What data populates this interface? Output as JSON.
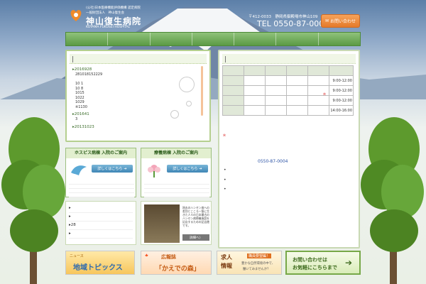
{
  "header": {
    "logo_sub1": "(公社)日本医療機能評価機構 認定病院",
    "logo_sub2": "一般財団法人　神山復生会",
    "logo_name": "神山復生病院",
    "logo_roman": "KOYAMA FUKUSEI HOSPITAL",
    "address": "〒412-0033　静岡県御殿場市神山109",
    "tel": "TEL 0550-87-0004",
    "contact_label": "お問い合わせ"
  },
  "news": {
    "entries": [
      {
        "date": "▸2016928",
        "lines": [
          "281018152229",
          "",
          "10  1",
          "10  8",
          "1015",
          "1022",
          "1029",
          "※1130"
        ]
      },
      {
        "date": "▸201641",
        "lines": [
          "3"
        ]
      },
      {
        "date": "▸20131023",
        "lines": []
      }
    ]
  },
  "schedule": {
    "times": [
      "9:00-12:00",
      "9:00-12:00",
      "9:00-12:00",
      "14:00-16:00"
    ],
    "tel": "0550-87-0004"
  },
  "hospice": {
    "title": "ホスピス病棟 入院のご案内",
    "button": "詳しくはこちら"
  },
  "care": {
    "title": "療養病棟 入院のご案内",
    "button": "詳しくはこちら"
  },
  "links": {
    "item_28": "28"
  },
  "book": {
    "text": "過去のハンセン病への差別とこころ一筋に生きた人々の日本最古のハンセン病療養施設を記念するための記念館です。",
    "detail": "詳細へ〉"
  },
  "banners": {
    "news_tag": "ニュース",
    "news_label": "地域トピックス",
    "book_tag": "広報誌",
    "book_label": "「かえでの森」",
    "job_tag1": "求人",
    "job_tag2": "情報",
    "job_head": "職員要望編！",
    "job_text1": "豊かな自然環境の中で、",
    "job_text2": "働いてみませんか？",
    "contact1": "お問い合わせは",
    "contact2": "お気軽にこちらまで"
  },
  "colors": {
    "nav_green": "#5b9a45",
    "accent_orange": "#e57a2a",
    "tel_blue": "#2d54a6"
  }
}
